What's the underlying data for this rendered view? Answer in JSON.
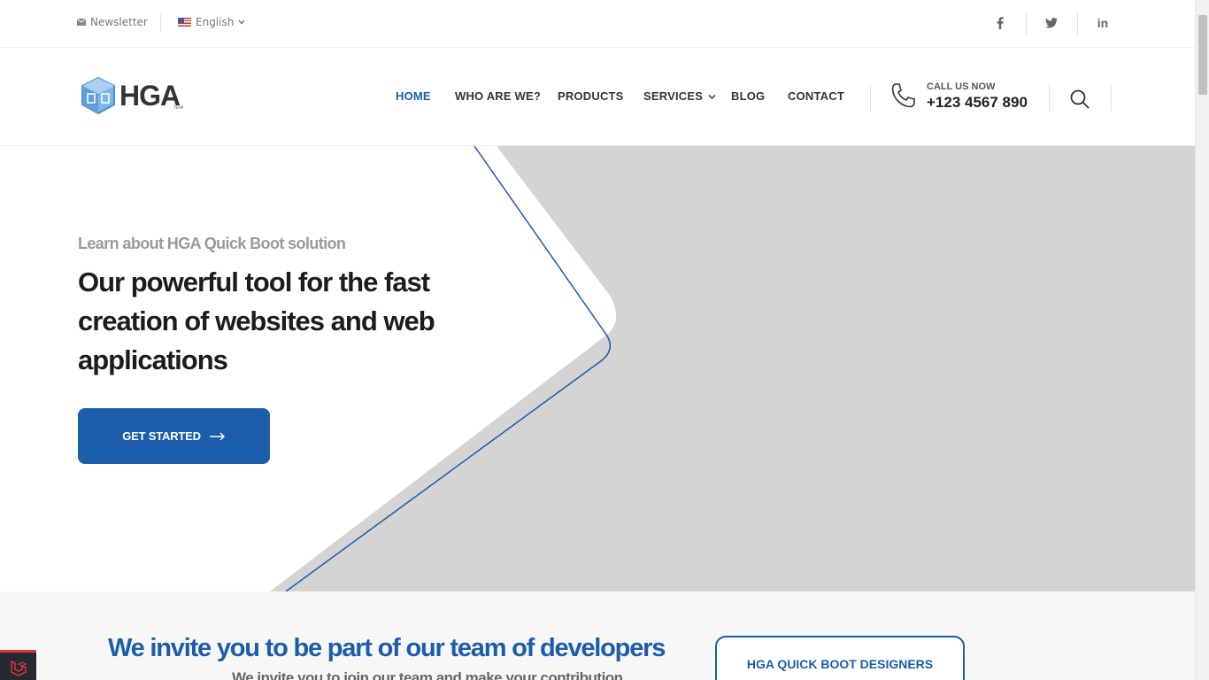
{
  "topbar": {
    "newsletter": "Newsletter",
    "language": "English",
    "social": [
      {
        "icon": "facebook-icon",
        "glyph": "f"
      },
      {
        "icon": "twitter-icon",
        "glyph": "t"
      },
      {
        "icon": "linkedin-icon",
        "glyph": "in"
      }
    ]
  },
  "header": {
    "logo_text": "HGA",
    "logo_tagline": "TEAM",
    "nav": [
      {
        "label": "HOME",
        "active": true
      },
      {
        "label": "WHO ARE WE?",
        "active": false
      },
      {
        "label": "PRODUCTS",
        "active": false
      },
      {
        "label": "SERVICES",
        "active": false,
        "dropdown": true
      },
      {
        "label": "BLOG",
        "active": false
      },
      {
        "label": "CONTACT",
        "active": false
      }
    ],
    "call_label": "CALL US NOW",
    "call_number": "+123 4567 890"
  },
  "hero": {
    "subtitle": "Learn about HGA Quick Boot solution",
    "title": "Our powerful tool for the fast creation of websites and web applications",
    "button": "GET STARTED"
  },
  "section": {
    "title": "We invite you to be part of our team of developers",
    "subtitle": "We invite you to join our team and make your contribution",
    "card_label": "HGA QUICK BOOT DESIGNERS"
  },
  "colors": {
    "accent": "#1b5dab",
    "hero_gray": "#d4d4d4",
    "section_bg": "#f7f7f7"
  }
}
